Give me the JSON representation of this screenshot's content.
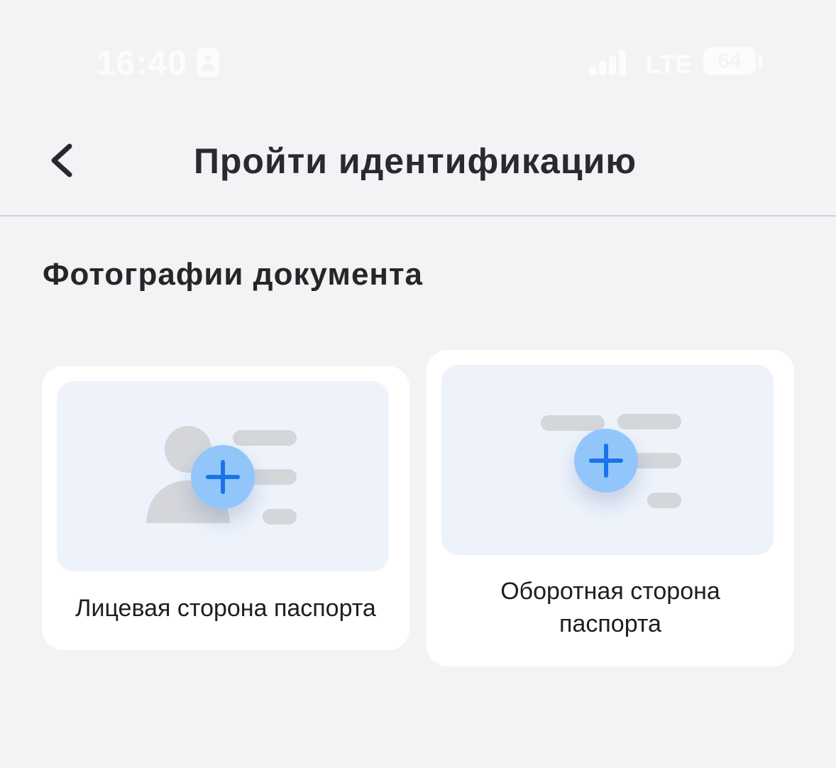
{
  "status_bar": {
    "time": "16:40",
    "network": "LTE",
    "battery": "64"
  },
  "header": {
    "title": "Пройти идентификацию"
  },
  "section": {
    "title": "Фотографии документа"
  },
  "cards": [
    {
      "label": "Лицевая сторона паспорта"
    },
    {
      "label_line1": "Оборотная сторона",
      "label_line2": "паспорта"
    }
  ],
  "colors": {
    "background": "#f2f3f5",
    "card": "#ffffff",
    "preview": "#eef3fb",
    "accent_circle": "#92c6fa",
    "accent_plus": "#1a73e8",
    "placeholder_gray": "#d4d6da"
  }
}
